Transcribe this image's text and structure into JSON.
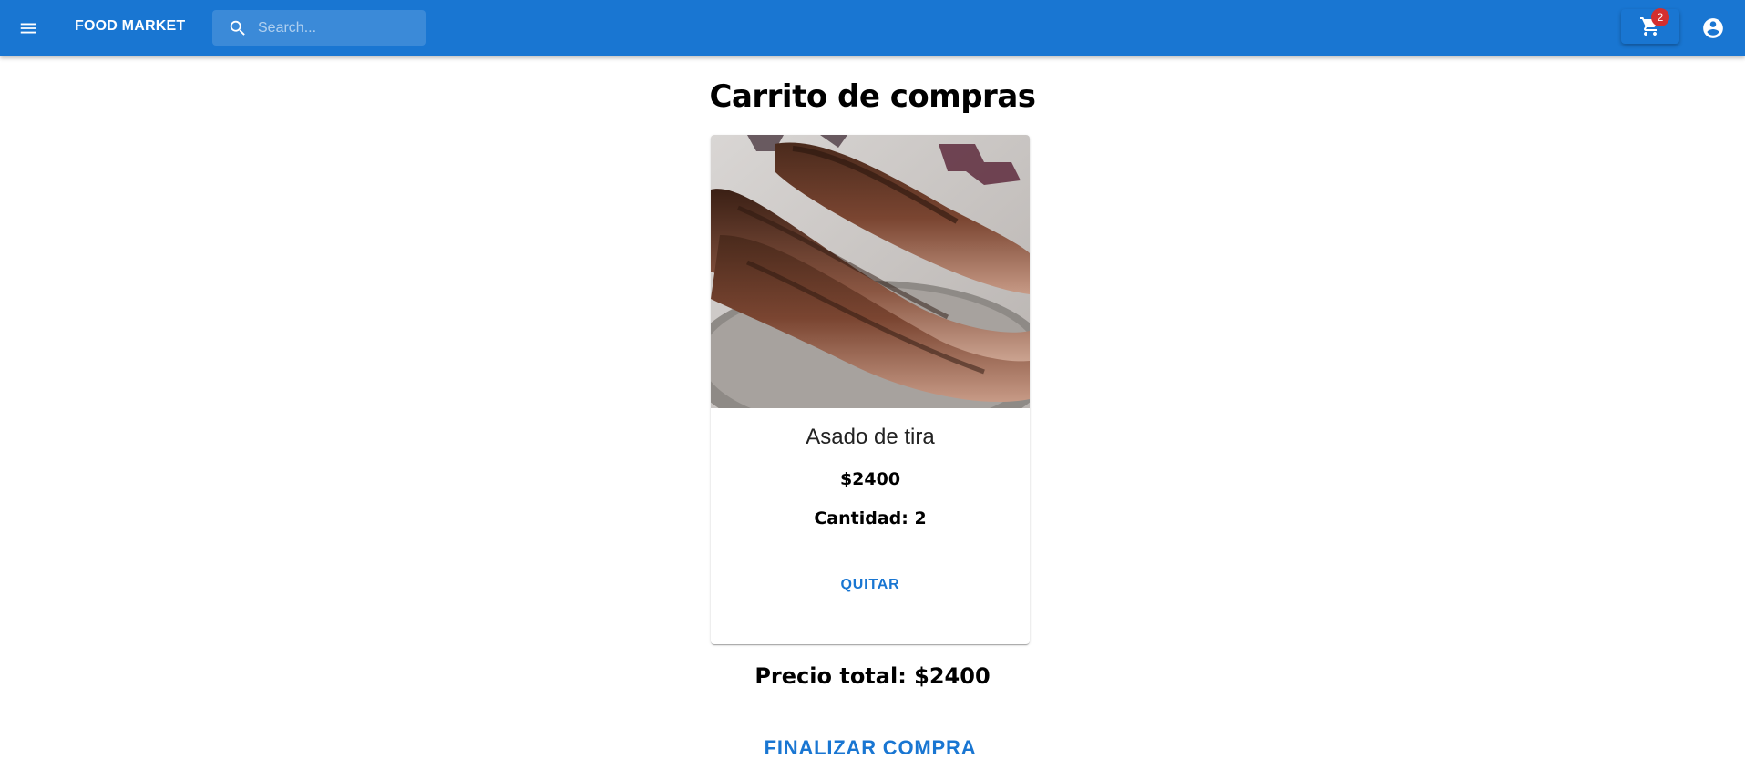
{
  "appbar": {
    "brand": "FOOD MARKET",
    "search_placeholder": "Search...",
    "cart_count": "2",
    "color": "#1976d2"
  },
  "page": {
    "title": "Carrito de compras"
  },
  "cart_items": [
    {
      "name": "Asado de tira",
      "price": "$2400",
      "quantity": "Cantidad: 2",
      "remove_label": "QUITAR",
      "image": "grilled-beef-ribs"
    }
  ],
  "summary": {
    "total": "Precio total: $2400",
    "checkout_label": "FINALIZAR COMPRA"
  },
  "icons": {
    "menu": "menu-icon",
    "search": "search-icon",
    "cart": "shopping-cart-icon",
    "account": "account-circle-icon"
  },
  "colors": {
    "primary": "#1976d2",
    "badge": "#d32f2f"
  }
}
